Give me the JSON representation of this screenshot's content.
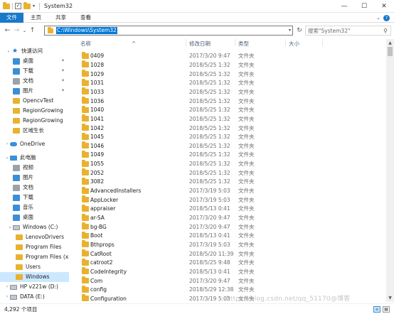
{
  "window": {
    "title": "System32",
    "minimize_glyph": "—",
    "maximize_glyph": "☐",
    "close_glyph": "✕"
  },
  "ribbon": {
    "tabs": [
      "文件",
      "主页",
      "共享",
      "查看"
    ],
    "expand_glyph": "⌄",
    "help_glyph": "?"
  },
  "nav": {
    "back_glyph": "←",
    "forward_glyph": "→",
    "recent_glyph": "⌄",
    "up_glyph": "↑",
    "address": "C:\\Windows\\System32",
    "refresh_glyph": "↻",
    "search_placeholder": "搜索\"System32\"",
    "search_glyph": "⚲"
  },
  "sidebar": {
    "items": [
      {
        "label": "快速访问",
        "icon": "star-icon"
      },
      {
        "label": "桌面",
        "icon": "desktop-icon",
        "pinned": true
      },
      {
        "label": "下载",
        "icon": "downloads-icon",
        "pinned": true
      },
      {
        "label": "文档",
        "icon": "documents-icon",
        "pinned": true
      },
      {
        "label": "图片",
        "icon": "pictures-icon",
        "pinned": true
      },
      {
        "label": "OpencvTest",
        "icon": "folder-icon"
      },
      {
        "label": "RegionGrowing",
        "icon": "folder-icon"
      },
      {
        "label": "RegionGrowing",
        "icon": "folder-icon"
      },
      {
        "label": "区域生长",
        "icon": "folder-icon"
      },
      {
        "label": "OneDrive",
        "icon": "onedrive-icon"
      },
      {
        "label": "此电脑",
        "icon": "pc-icon"
      },
      {
        "label": "视频",
        "icon": "videos-icon"
      },
      {
        "label": "图片",
        "icon": "pictures-icon"
      },
      {
        "label": "文档",
        "icon": "documents-icon"
      },
      {
        "label": "下载",
        "icon": "downloads-icon"
      },
      {
        "label": "音乐",
        "icon": "music-icon"
      },
      {
        "label": "桌面",
        "icon": "desktop-icon"
      },
      {
        "label": "Windows (C:)",
        "icon": "drive-icon"
      },
      {
        "label": "LenovoDrivers",
        "icon": "folder-icon"
      },
      {
        "label": "Program Files",
        "icon": "folder-icon"
      },
      {
        "label": "Program Files (x8",
        "icon": "folder-icon"
      },
      {
        "label": "Users",
        "icon": "folder-icon"
      },
      {
        "label": "Windows",
        "icon": "folder-icon",
        "selected": true
      },
      {
        "label": "HP v221w (D:)",
        "icon": "drive-icon"
      },
      {
        "label": "DATA (E:)",
        "icon": "drive-icon"
      }
    ],
    "pin_glyph": "📌",
    "expand_glyph": "›",
    "collapse_glyph": "⌄"
  },
  "columns": {
    "name": "名称",
    "date": "修改日期",
    "type": "类型",
    "size": "大小",
    "sort_glyph": "^"
  },
  "files": [
    {
      "name": "0409",
      "date": "2017/3/20 9:47",
      "type": "文件夹"
    },
    {
      "name": "1028",
      "date": "2018/5/25 1:32",
      "type": "文件夹"
    },
    {
      "name": "1029",
      "date": "2018/5/25 1:32",
      "type": "文件夹"
    },
    {
      "name": "1031",
      "date": "2018/5/25 1:32",
      "type": "文件夹"
    },
    {
      "name": "1033",
      "date": "2018/5/25 1:32",
      "type": "文件夹"
    },
    {
      "name": "1036",
      "date": "2018/5/25 1:32",
      "type": "文件夹"
    },
    {
      "name": "1040",
      "date": "2018/5/25 1:32",
      "type": "文件夹"
    },
    {
      "name": "1041",
      "date": "2018/5/25 1:32",
      "type": "文件夹"
    },
    {
      "name": "1042",
      "date": "2018/5/25 1:32",
      "type": "文件夹"
    },
    {
      "name": "1045",
      "date": "2018/5/25 1:32",
      "type": "文件夹"
    },
    {
      "name": "1046",
      "date": "2018/5/25 1:32",
      "type": "文件夹"
    },
    {
      "name": "1049",
      "date": "2018/5/25 1:32",
      "type": "文件夹"
    },
    {
      "name": "1055",
      "date": "2018/5/25 1:32",
      "type": "文件夹"
    },
    {
      "name": "2052",
      "date": "2018/5/25 1:32",
      "type": "文件夹"
    },
    {
      "name": "3082",
      "date": "2018/5/25 1:32",
      "type": "文件夹"
    },
    {
      "name": "AdvancedInstallers",
      "date": "2017/3/19 5:03",
      "type": "文件夹"
    },
    {
      "name": "AppLocker",
      "date": "2017/3/19 5:03",
      "type": "文件夹"
    },
    {
      "name": "appraiser",
      "date": "2018/5/13 0:41",
      "type": "文件夹"
    },
    {
      "name": "ar-SA",
      "date": "2017/3/20 9:47",
      "type": "文件夹"
    },
    {
      "name": "bg-BG",
      "date": "2017/3/20 9:47",
      "type": "文件夹"
    },
    {
      "name": "Boot",
      "date": "2018/5/13 0:41",
      "type": "文件夹"
    },
    {
      "name": "Bthprops",
      "date": "2017/3/19 5:03",
      "type": "文件夹"
    },
    {
      "name": "CatRoot",
      "date": "2018/5/20 11:39",
      "type": "文件夹"
    },
    {
      "name": "catroot2",
      "date": "2018/5/25 9:48",
      "type": "文件夹"
    },
    {
      "name": "CodeIntegrity",
      "date": "2018/5/13 0:41",
      "type": "文件夹"
    },
    {
      "name": "Com",
      "date": "2017/3/20 9:47",
      "type": "文件夹"
    },
    {
      "name": "config",
      "date": "2018/5/29 12:38",
      "type": "文件夹"
    },
    {
      "name": "Configuration",
      "date": "2017/3/19 5:03",
      "type": "文件夹"
    }
  ],
  "status": {
    "count": "4,292 个项目",
    "details_glyph": "≡",
    "tiles_glyph": "▦"
  },
  "watermark": "https://blog.csdn.net/qq_51170@博客"
}
